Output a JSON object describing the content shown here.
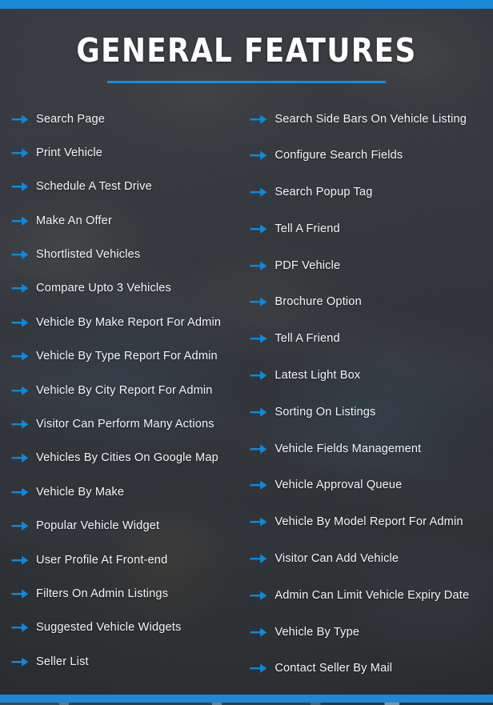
{
  "theme": {
    "accent_blue": "#1a8ad8",
    "arrow_blue": "#0d8ae0",
    "background_dark": "#35393d",
    "text_white": "#f2f3f4"
  },
  "header": {
    "title": "GENERAL FEATURES"
  },
  "features": {
    "left_column": [
      {
        "icon": "arrow-right-icon",
        "label": "Search Page"
      },
      {
        "icon": "arrow-right-icon",
        "label": "Print Vehicle"
      },
      {
        "icon": "arrow-right-icon",
        "label": "Schedule A Test Drive"
      },
      {
        "icon": "arrow-right-icon",
        "label": "Make An Offer"
      },
      {
        "icon": "arrow-right-icon",
        "label": "Shortlisted Vehicles"
      },
      {
        "icon": "arrow-right-icon",
        "label": "Compare Upto 3 Vehicles"
      },
      {
        "icon": "arrow-right-icon",
        "label": "Vehicle By Make Report For Admin"
      },
      {
        "icon": "arrow-right-icon",
        "label": "Vehicle By Type Report For Admin"
      },
      {
        "icon": "arrow-right-icon",
        "label": "Vehicle By City Report For Admin"
      },
      {
        "icon": "arrow-right-icon",
        "label": "Visitor Can Perform Many Actions"
      },
      {
        "icon": "arrow-right-icon",
        "label": "Vehicles By Cities On Google Map"
      },
      {
        "icon": "arrow-right-icon",
        "label": "Vehicle By Make"
      },
      {
        "icon": "arrow-right-icon",
        "label": "Popular Vehicle Widget"
      },
      {
        "icon": "arrow-right-icon",
        "label": "User Profile At Front-end"
      },
      {
        "icon": "arrow-right-icon",
        "label": "Filters On Admin Listings"
      },
      {
        "icon": "arrow-right-icon",
        "label": "Suggested Vehicle Widgets"
      },
      {
        "icon": "arrow-right-icon",
        "label": "Seller List"
      }
    ],
    "right_column": [
      {
        "icon": "arrow-right-icon",
        "label": "Search Side Bars On Vehicle Listing"
      },
      {
        "icon": "arrow-right-icon",
        "label": "Configure Search Fields"
      },
      {
        "icon": "arrow-right-icon",
        "label": "Search Popup Tag"
      },
      {
        "icon": "arrow-right-icon",
        "label": "Tell A Friend"
      },
      {
        "icon": "arrow-right-icon",
        "label": "PDF Vehicle"
      },
      {
        "icon": "arrow-right-icon",
        "label": "Brochure Option"
      },
      {
        "icon": "arrow-right-icon",
        "label": "Tell A Friend"
      },
      {
        "icon": "arrow-right-icon",
        "label": "Latest Light Box"
      },
      {
        "icon": "arrow-right-icon",
        "label": "Sorting On Listings"
      },
      {
        "icon": "arrow-right-icon",
        "label": "Vehicle Fields Management"
      },
      {
        "icon": "arrow-right-icon",
        "label": "Vehicle Approval Queue"
      },
      {
        "icon": "arrow-right-icon",
        "label": "Vehicle By Model Report For Admin"
      },
      {
        "icon": "arrow-right-icon",
        "label": "Visitor Can Add Vehicle"
      },
      {
        "icon": "arrow-right-icon",
        "label": "Admin Can Limit Vehicle Expiry Date"
      },
      {
        "icon": "arrow-right-icon",
        "label": "Vehicle By Type"
      },
      {
        "icon": "arrow-right-icon",
        "label": "Contact Seller By Mail"
      }
    ]
  }
}
